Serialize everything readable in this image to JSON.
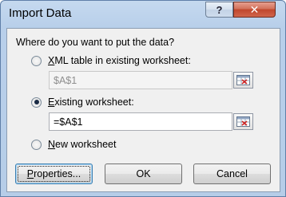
{
  "window": {
    "title": "Import Data"
  },
  "titlebar": {
    "help_label": "?",
    "close_label": "✕"
  },
  "dialog": {
    "question": "Where do you want to put the data?",
    "options": [
      {
        "accel": "X",
        "rest": "ML table in existing worksheet:",
        "selected": false
      },
      {
        "accel": "E",
        "rest": "xisting worksheet:",
        "selected": true
      },
      {
        "accel": "N",
        "rest": "ew worksheet",
        "selected": false
      }
    ],
    "xml_ref_value": "$A$1",
    "existing_ref_value": "=$A$1"
  },
  "buttons": {
    "properties_accel": "P",
    "properties_rest": "roperties...",
    "ok_label": "OK",
    "cancel_label": "Cancel"
  },
  "icons": {
    "range_picker": "range-select-icon"
  }
}
